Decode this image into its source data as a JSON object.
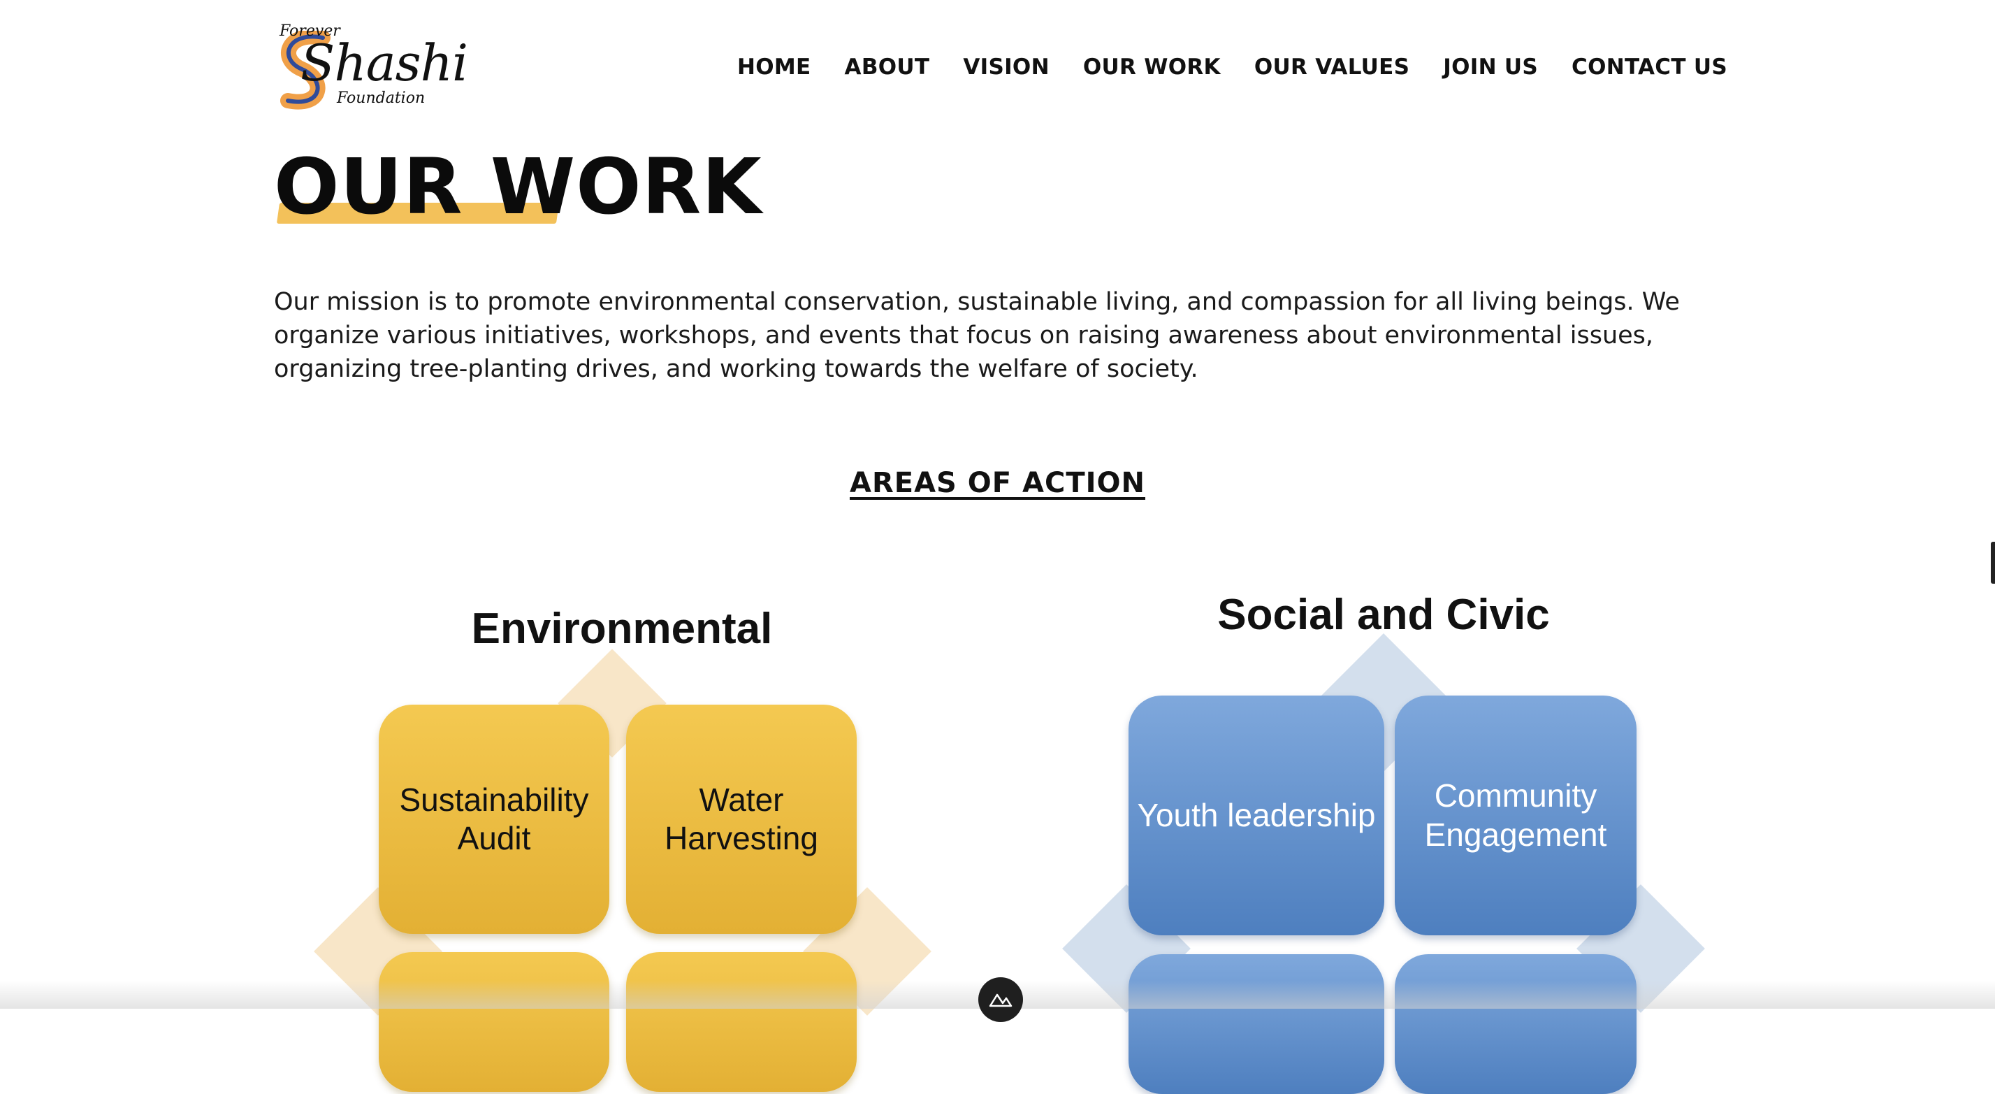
{
  "logo": {
    "line1": "Forever",
    "line2": "Shashi",
    "line3": "Foundation"
  },
  "nav": {
    "items": [
      {
        "label": "HOME"
      },
      {
        "label": "ABOUT"
      },
      {
        "label": "VISION"
      },
      {
        "label": "OUR WORK"
      },
      {
        "label": "OUR VALUES"
      },
      {
        "label": "JOIN US"
      },
      {
        "label": "CONTACT US"
      }
    ]
  },
  "main": {
    "title": "OUR WORK",
    "mission": "Our mission is to promote environmental conservation, sustainable living, and compassion for all living beings. We organize various initiatives, workshops, and events that focus on raising awareness about environmental issues, organizing tree-planting drives, and working towards the welfare of society.",
    "areas_heading": "AREAS OF ACTION"
  },
  "diagrams": {
    "environmental": {
      "title": "Environmental",
      "tiles": [
        {
          "label": "Sustainability Audit"
        },
        {
          "label": "Water Harvesting"
        }
      ]
    },
    "social": {
      "title": "Social and Civic",
      "tiles": [
        {
          "label": "Youth leadership"
        },
        {
          "label": "Community Engagement"
        }
      ]
    }
  },
  "colors": {
    "accent_yellow": "#f3c15a",
    "tile_yellow": "#f4c951",
    "tile_blue": "#6b96d0"
  }
}
